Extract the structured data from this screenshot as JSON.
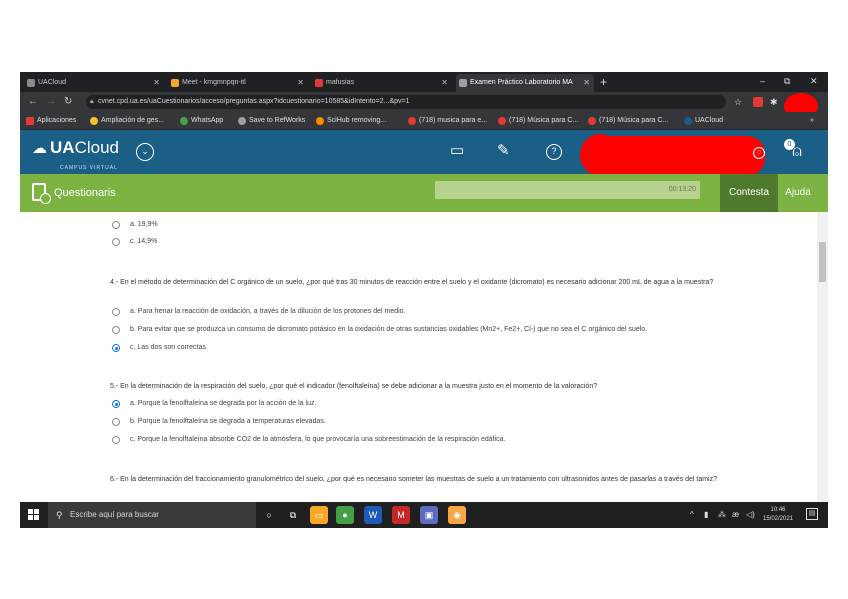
{
  "browser": {
    "tabs": [
      {
        "label": "UACloud",
        "active": false
      },
      {
        "label": "Meet - kmgmnpqn-itl",
        "active": false
      },
      {
        "label": "mafusias",
        "active": false
      },
      {
        "label": "Examen Práctico Laboratorio MA",
        "active": true
      }
    ],
    "new_tab": "+",
    "window_controls": [
      "–",
      "⧉",
      "✕"
    ],
    "url": "cvnet.cpd.ua.es/uaCuestionarios/acceso/preguntas.aspx?idcuestionario=10585&idIntento=2...&pv=1",
    "bookmarks": [
      {
        "label": "Aplicaciones",
        "color": "#e53935"
      },
      {
        "label": "Ampliación de ges...",
        "color": "#fbc02d"
      },
      {
        "label": "WhatsApp",
        "color": "#43a047"
      },
      {
        "label": "Save to RefWorks",
        "color": "#9e9e9e"
      },
      {
        "label": "SciHub removing...",
        "color": "#fb8c00"
      },
      {
        "label": "(718) musica para e...",
        "color": "#e53935"
      },
      {
        "label": "(718) Música para C...",
        "color": "#e53935"
      },
      {
        "label": "(718) Música para C...",
        "color": "#e53935"
      },
      {
        "label": "UACloud",
        "color": "#1b5e86"
      },
      {
        "label": "»",
        "color": "transparent"
      }
    ]
  },
  "header": {
    "logo_a": "UA",
    "logo_b": "Cloud",
    "logo_sub": "CAMPUS VIRTUAL",
    "notification_count": "0"
  },
  "subheader": {
    "title": "Questionaris",
    "search_value": "00:13:20",
    "contesta": "Contesta",
    "ayuda": "Ajuda"
  },
  "content": {
    "prev_options": [
      {
        "text": "a. 19,9%",
        "selected": false
      },
      {
        "text": "c. 14,9%",
        "selected": false
      }
    ],
    "questions": [
      {
        "text": "4.- En el método de determinación del C orgánico de un suelo, ¿por qué tras 30 minutos de reacción entre el suelo y el oxidante (dicromato) es necesario adicionar 200 mL de agua a la muestra?",
        "options": [
          {
            "text": "a. Para frenar la reacción de oxidación, a través de la dilución de los protones del medio.",
            "selected": false
          },
          {
            "text": "b. Para evitar que se produzca un consumo de dicromato potásico en la oxidación de otras sustancias oxidables (Mn2+, Fe2+, Cl-) que no sea el C orgánico del suelo.",
            "selected": false
          },
          {
            "text": "c. Las dos son correctas.",
            "selected": true
          }
        ]
      },
      {
        "text": "5.- En la determinación de la respiración del suelo, ¿por qué el indicador (fenolftaleína) se debe adicionar a la muestra justo en el momento de la valoración?",
        "options": [
          {
            "text": "a. Porque la fenolftaleína se degrada por la acción de la luz.",
            "selected": true
          },
          {
            "text": "b. Porque la fenolftaleína se degrada a temperaturas elevadas.",
            "selected": false
          },
          {
            "text": "c. Porque la fenolftaleína absorbe CO2 de la atmósfera, lo que provocaría una sobreestimación de la respiración edáfica.",
            "selected": false
          }
        ]
      },
      {
        "text": "6.- En la determinación del fraccionamiento granulométrico del suelo, ¿por qué es necesario someter las muestras de suelo a un tratamiento con ultrasonidos antes de pasarlas a través del tamiz?",
        "options": []
      }
    ]
  },
  "taskbar": {
    "search_placeholder": "Escribe aquí para buscar",
    "apps": [
      {
        "icon": "cortana-icon",
        "color": "#1f1f1f",
        "glyph": "○"
      },
      {
        "icon": "task-view-icon",
        "color": "#1f1f1f",
        "glyph": "⧉"
      },
      {
        "icon": "file-explorer-icon",
        "color": "#f9a825",
        "glyph": "▭"
      },
      {
        "icon": "chrome-icon",
        "color": "#43a047",
        "glyph": "●"
      },
      {
        "icon": "word-icon",
        "color": "#1e5bb8",
        "glyph": "W"
      },
      {
        "icon": "app-red-icon",
        "color": "#c62828",
        "glyph": "M"
      },
      {
        "icon": "paint-icon",
        "color": "#5c6bc0",
        "glyph": "▣"
      },
      {
        "icon": "photos-icon",
        "color": "#f4a742",
        "glyph": "◉"
      }
    ],
    "time": "10:46",
    "date": "15/02/2021"
  }
}
